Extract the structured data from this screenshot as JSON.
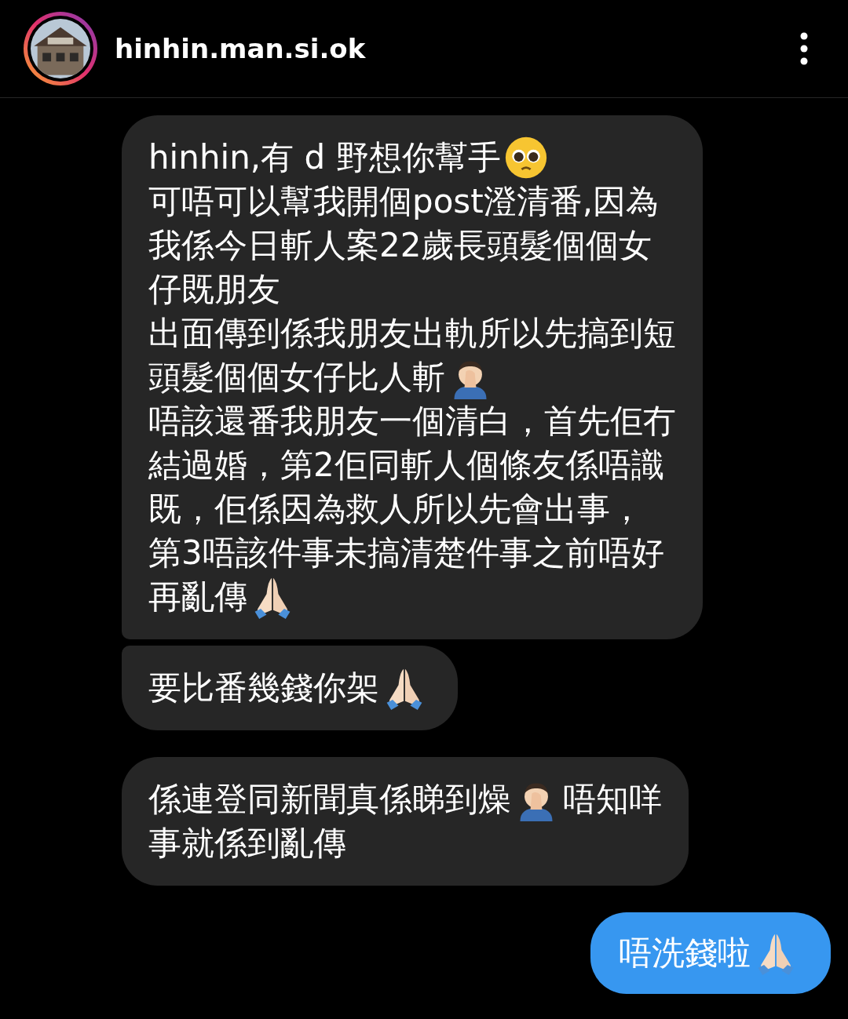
{
  "header": {
    "username": "hinhin.man.si.ok"
  },
  "messages": [
    {
      "kind": "received",
      "lines": [
        [
          {
            "kind": "text",
            "text": "hinhin,有 d 野想你幫手"
          },
          {
            "kind": "pleading-face"
          }
        ],
        [
          {
            "kind": "text",
            "text": "可唔可以幫我開個post澄清番,因為"
          }
        ],
        [
          {
            "kind": "text",
            "text": "我係今日斬人案22歲長頭髮個個女"
          }
        ],
        [
          {
            "kind": "text",
            "text": "仔既朋友"
          }
        ],
        [
          {
            "kind": "text",
            "text": "出面傳到係我朋友出軌所以先搞到短"
          }
        ],
        [
          {
            "kind": "text",
            "text": "頭髮個個女仔比人斬"
          },
          {
            "kind": "facepalm"
          }
        ],
        [
          {
            "kind": "text",
            "text": "唔該還番我朋友一個清白，首先佢冇"
          }
        ],
        [
          {
            "kind": "text",
            "text": "結過婚，第2佢同斬人個條友係唔識"
          }
        ],
        [
          {
            "kind": "text",
            "text": "既，佢係因為救人所以先會出事，"
          }
        ],
        [
          {
            "kind": "text",
            "text": "第3唔該件事未搞清楚件事之前唔好"
          }
        ],
        [
          {
            "kind": "text",
            "text": "再亂傳"
          },
          {
            "kind": "praying-hands"
          }
        ]
      ]
    },
    {
      "kind": "received",
      "lines": [
        [
          {
            "kind": "text",
            "text": "要比番幾錢你架"
          },
          {
            "kind": "praying-hands"
          }
        ]
      ]
    },
    {
      "kind": "received",
      "lines": [
        [
          {
            "kind": "text",
            "text": "係連登同新聞真係睇到燥"
          },
          {
            "kind": "facepalm"
          },
          {
            "kind": "text",
            "text": "唔知咩"
          }
        ],
        [
          {
            "kind": "text",
            "text": "事就係到亂傳"
          }
        ]
      ]
    },
    {
      "kind": "sent",
      "lines": [
        [
          {
            "kind": "text",
            "text": "唔洗錢啦"
          },
          {
            "kind": "praying-hands"
          }
        ]
      ]
    }
  ]
}
